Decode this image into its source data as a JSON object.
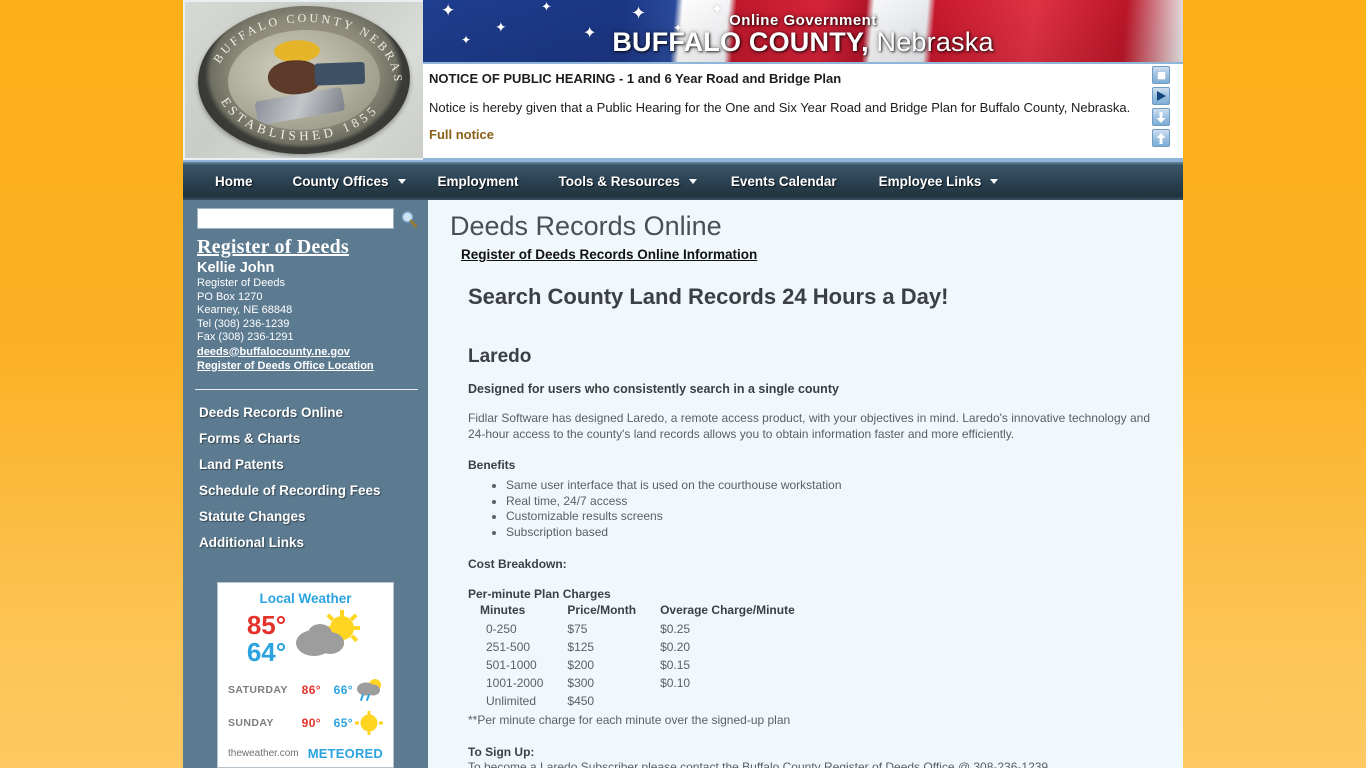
{
  "banner": {
    "subtitle": "Online Government",
    "county": "BUFFALO COUNTY,",
    "state": "Nebraska",
    "seal_text_top": "BUFFALO COUNTY NEBRASKA",
    "seal_text_bottom": "ESTABLISHED 1855"
  },
  "notice": {
    "title": "NOTICE OF PUBLIC HEARING - 1 and 6 Year Road and Bridge Plan",
    "body": "Notice is hereby given that a Public Hearing for the One and Six Year Road and Bridge Plan for Buffalo County, Nebraska.",
    "link": "Full notice",
    "controls": [
      {
        "name": "stop-button",
        "icon": "stop-icon"
      },
      {
        "name": "play-button",
        "icon": "play-icon"
      },
      {
        "name": "scroll-down-button",
        "icon": "arrow-down-icon"
      },
      {
        "name": "scroll-up-button",
        "icon": "arrow-up-icon"
      }
    ]
  },
  "nav": {
    "items": [
      {
        "label": "Home",
        "dropdown": false
      },
      {
        "label": "County Offices",
        "dropdown": true
      },
      {
        "label": "Employment",
        "dropdown": false
      },
      {
        "label": "Tools & Resources",
        "dropdown": true
      },
      {
        "label": "Events Calendar",
        "dropdown": false
      },
      {
        "label": "Employee Links",
        "dropdown": true
      }
    ]
  },
  "sidebar": {
    "search": {
      "value": "",
      "placeholder": ""
    },
    "office": {
      "title": "Register of Deeds",
      "officer": "Kellie John",
      "role": "Register of Deeds",
      "address1": "PO Box 1270",
      "address2": "Kearney, NE 68848",
      "tel": "Tel (308) 236-1239",
      "fax": "Fax (308) 236-1291",
      "email": "deeds@buffalocounty.ne.gov",
      "location_link": "Register of Deeds Office Location"
    },
    "menu": [
      "Deeds Records Online",
      "Forms & Charts",
      "Land Patents",
      "Schedule of Recording Fees",
      "Statute Changes",
      "Additional Links"
    ]
  },
  "weather": {
    "title": "Local Weather",
    "current": {
      "high": "85°",
      "low": "64°",
      "icon": "partly-cloudy-icon"
    },
    "forecast": [
      {
        "day": "SATURDAY",
        "high": "86°",
        "low": "66°",
        "icon": "rain-showers-icon"
      },
      {
        "day": "SUNDAY",
        "high": "90°",
        "low": "65°",
        "icon": "sunny-icon"
      }
    ],
    "source": "theweather.com",
    "brand": "METEORED"
  },
  "main": {
    "title": "Deeds Records Online",
    "subtitle": "Register of Deeds Records Online Information",
    "hero": "Search County Land Records 24 Hours a Day!",
    "section_title": "Laredo",
    "lead": "Designed for users who consistently search in a single county",
    "paragraph": "Fidlar Software has designed Laredo, a remote access product, with your objectives in mind. Laredo's innovative technology and 24-hour access to the county's land records allows you to obtain information faster and more efficiently.",
    "benefits_label": "Benefits",
    "benefits": [
      "Same user interface that is used on the courthouse workstation",
      "Real time, 24/7 access",
      "Customizable results screens",
      "Subscription based"
    ],
    "cost_heading": "Cost Breakdown:",
    "plan_heading": "Per-minute Plan Charges",
    "table": {
      "columns": [
        "Minutes",
        "Price/Month",
        "Overage Charge/Minute"
      ],
      "rows": [
        [
          "0-250",
          "$75",
          "$0.25"
        ],
        [
          "251-500",
          "$125",
          "$0.20"
        ],
        [
          "501-1000",
          "$200",
          "$0.15"
        ],
        [
          "1001-2000",
          "$300",
          "$0.10"
        ],
        [
          "Unlimited",
          "$450",
          ""
        ]
      ]
    },
    "footnote": "**Per minute charge for each minute over the signed-up plan",
    "signup_label": "To Sign Up:",
    "signup_text": "To become a Laredo Subscriber please contact the Buffalo County Register of Deeds Office @ 308-236-1239."
  },
  "colors": {
    "page_background": "#fbb125",
    "sidebar": "#5c7a90",
    "nav": "#2c4354",
    "content_background": "#f1f8fb",
    "notice_link": "#8a6118",
    "weather_accent": "#2aa3e0",
    "weather_hot": "#e4322b"
  }
}
